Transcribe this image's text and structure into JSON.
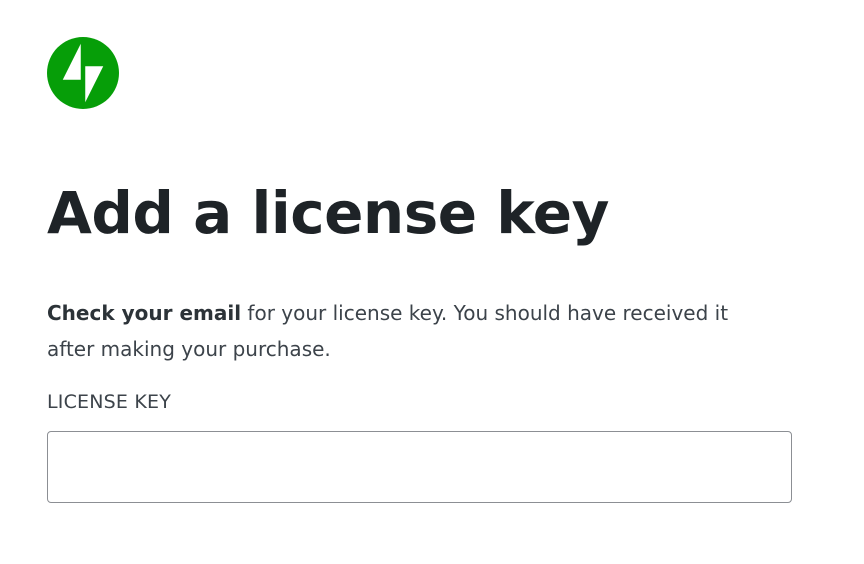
{
  "logo": {
    "icon": "jetpack-bolt-icon",
    "color": "#069e08"
  },
  "heading": {
    "title": "Add a license key"
  },
  "description": {
    "emphasis": "Check your email",
    "rest": " for your license key. You should have received it after making your purchase."
  },
  "form": {
    "label": "LICENSE KEY",
    "value": "",
    "placeholder": ""
  },
  "colors": {
    "brand": "#069e08",
    "text": "#1e2327",
    "border": "#8c8f94"
  }
}
